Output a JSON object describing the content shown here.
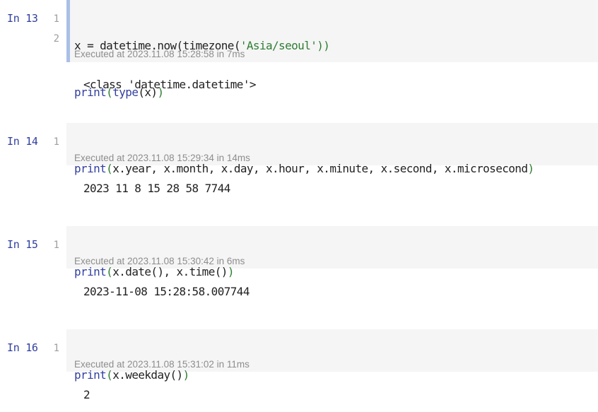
{
  "cells": [
    {
      "prompt": "In 13",
      "line_numbers": [
        "1",
        "2"
      ],
      "code": [
        {
          "pre": "x = datetime.now(timezone(",
          "str": "'Asia/seoul'",
          "post": "))"
        },
        {
          "fn": "print",
          "p1": "(",
          "fn2": "type",
          "p2": "(x)",
          "p3": ")"
        }
      ],
      "executed": "Executed at 2023.11.08 15:28:58 in 7ms",
      "output": "<class 'datetime.datetime'>"
    },
    {
      "prompt": "In 14",
      "line_numbers": [
        "1"
      ],
      "code": [
        {
          "fn": "print",
          "open": "(",
          "body": "x.year, x.month, x.day, x.hour, x.minute, x.second, x.microsecond",
          "close": ")"
        }
      ],
      "executed": "Executed at 2023.11.08 15:29:34 in 14ms",
      "output": "2023 11 8 15 28 58 7744"
    },
    {
      "prompt": "In 15",
      "line_numbers": [
        "1"
      ],
      "code": [
        {
          "fn": "print",
          "open": "(",
          "body": "x.date(), x.time()",
          "close": ")"
        }
      ],
      "executed": "Executed at 2023.11.08 15:30:42 in 6ms",
      "output": "2023-11-08 15:28:58.007744"
    },
    {
      "prompt": "In 16",
      "line_numbers": [
        "1"
      ],
      "code": [
        {
          "fn": "print",
          "open": "(",
          "body": "x.weekday()",
          "close": ")"
        }
      ],
      "executed": "Executed at 2023.11.08 15:31:02 in 11ms",
      "output": "2"
    }
  ]
}
